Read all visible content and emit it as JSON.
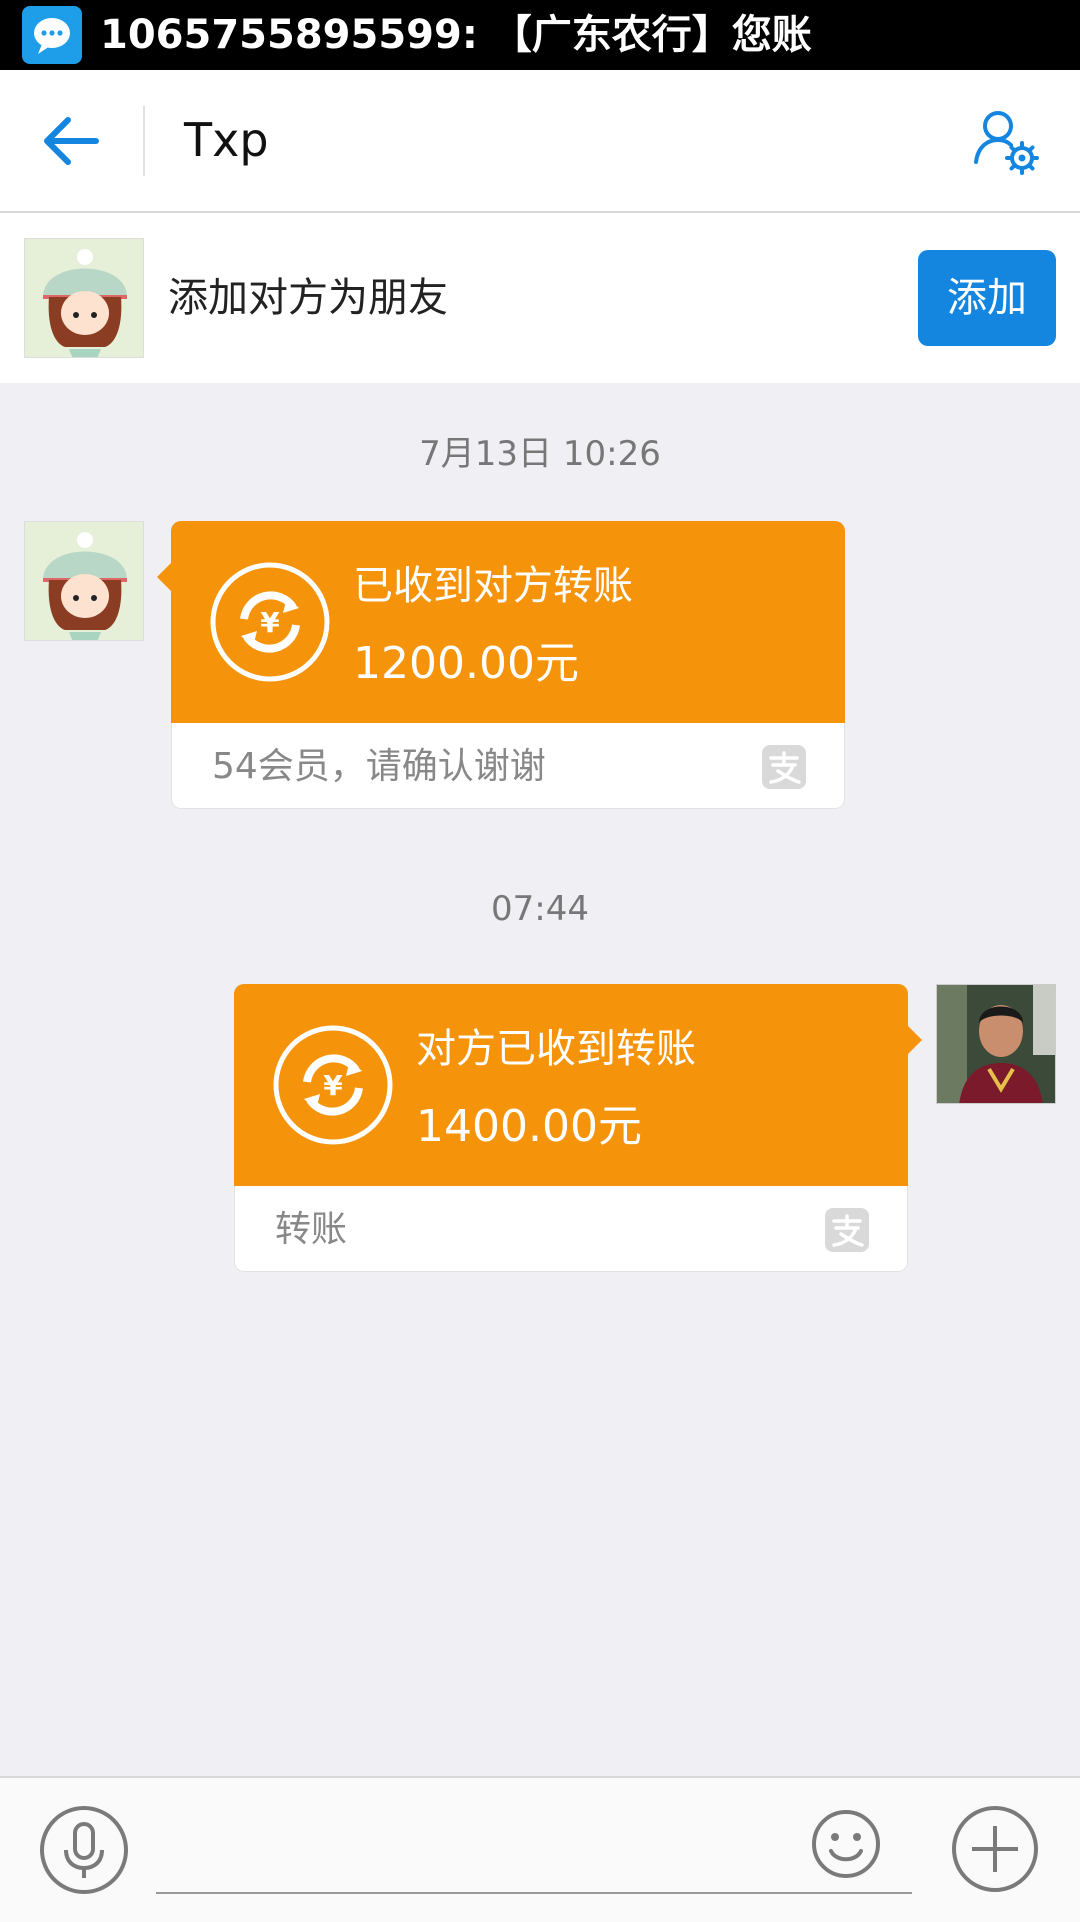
{
  "status_bar": {
    "notification_text": "1065755895599: 【广东农行】您账",
    "icon": "sms-notification-icon"
  },
  "nav": {
    "title": "Txp",
    "back_icon": "arrow-left-icon",
    "settings_icon": "contact-settings-icon"
  },
  "friend_banner": {
    "text": "添加对方为朋友",
    "button_label": "添加"
  },
  "messages": [
    {
      "timestamp": "7月13日 10:26",
      "sender": "other",
      "title": "已收到对方转账",
      "amount": "1200.00元",
      "note": "54会员，请确认谢谢"
    },
    {
      "timestamp": "07:44",
      "sender": "me",
      "title": "对方已收到转账",
      "amount": "1400.00元",
      "note": "转账"
    }
  ],
  "input_bar": {
    "placeholder": "",
    "icons": [
      "microphone-icon",
      "emoji-icon",
      "plus-icon"
    ]
  },
  "colors": {
    "accent_blue": "#1586e0",
    "transfer_orange": "#f5930b",
    "background": "#efeff4"
  }
}
